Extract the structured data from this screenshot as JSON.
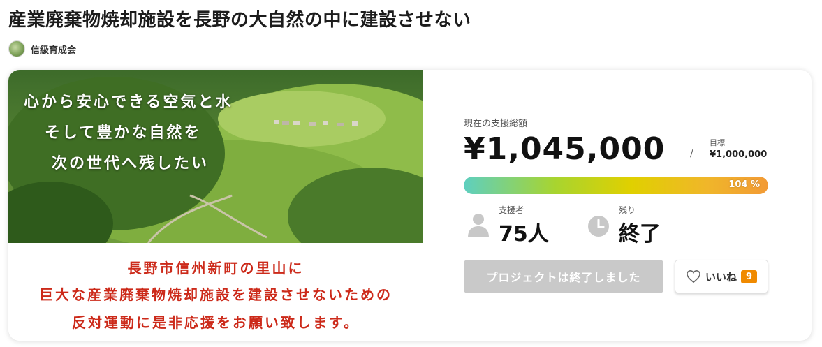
{
  "project": {
    "title": "産業廃棄物焼却施設を長野の大自然の中に建設させない",
    "owner": "信級育成会"
  },
  "hero": {
    "photo_lines": [
      "心から安心できる空気と水",
      "そして豊かな自然を",
      "次の世代へ残したい"
    ],
    "text_lines": [
      "長野市信州新町の里山に",
      "巨大な産業廃棄物焼却施設を建設させないための",
      "反対運動に是非応援をお願い致します。"
    ]
  },
  "funding": {
    "label": "現在の支援総額",
    "amount": "¥1,045,000",
    "separator": "/",
    "goal_label": "目標",
    "goal_value": "¥1,000,000",
    "progress_percent": 104,
    "progress_label": "104 %",
    "gradient_colors": [
      "#5ecfc0",
      "#a8d42f",
      "#e0d000",
      "#f0b62a",
      "#f29a35"
    ]
  },
  "stats": {
    "supporters_label": "支援者",
    "supporters_value": "75人",
    "remaining_label": "残り",
    "remaining_value": "終了"
  },
  "actions": {
    "ended_label": "プロジェクトは終了しました",
    "like_label": "いいね",
    "like_count": "9"
  },
  "icons": {
    "supporter": "person-icon",
    "remaining": "clock-icon",
    "like": "heart-icon"
  }
}
